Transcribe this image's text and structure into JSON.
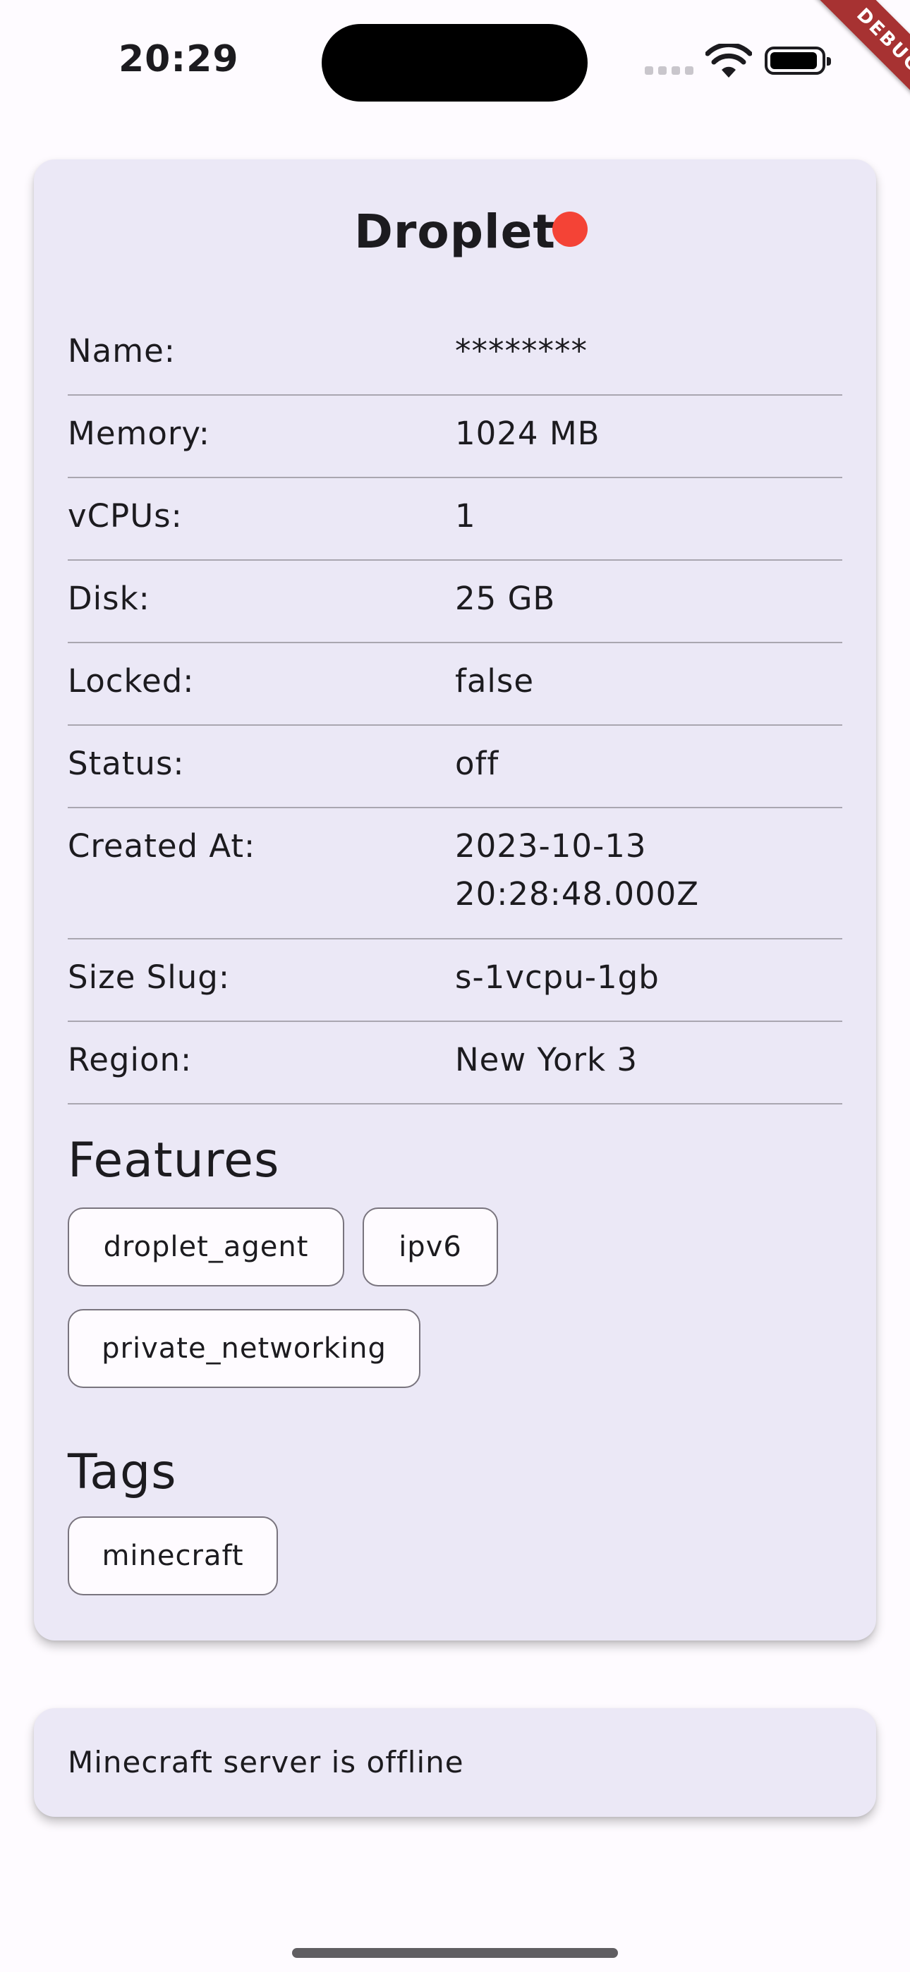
{
  "status_bar": {
    "time": "20:29",
    "icons": [
      "cellular-signal-icon",
      "wifi-icon",
      "battery-icon"
    ]
  },
  "debug_banner": "DEBUG",
  "droplet": {
    "title": "Droplet",
    "status_color": "#f44336",
    "rows": [
      {
        "label": "Name:",
        "value": "********"
      },
      {
        "label": "Memory:",
        "value": "1024 MB"
      },
      {
        "label": "vCPUs:",
        "value": "1"
      },
      {
        "label": "Disk:",
        "value": "25 GB"
      },
      {
        "label": "Locked:",
        "value": "false"
      },
      {
        "label": "Status:",
        "value": "off"
      },
      {
        "label": "Created At:",
        "value": "2023-10-13\n20:28:48.000Z"
      },
      {
        "label": "Size Slug:",
        "value": "s-1vcpu-1gb"
      },
      {
        "label": "Region:",
        "value": "New York 3"
      }
    ],
    "features_title": "Features",
    "features": [
      "droplet_agent",
      "ipv6",
      "private_networking"
    ],
    "tags_title": "Tags",
    "tags": [
      "minecraft"
    ]
  },
  "server_status": {
    "text": "Minecraft server is offline"
  }
}
